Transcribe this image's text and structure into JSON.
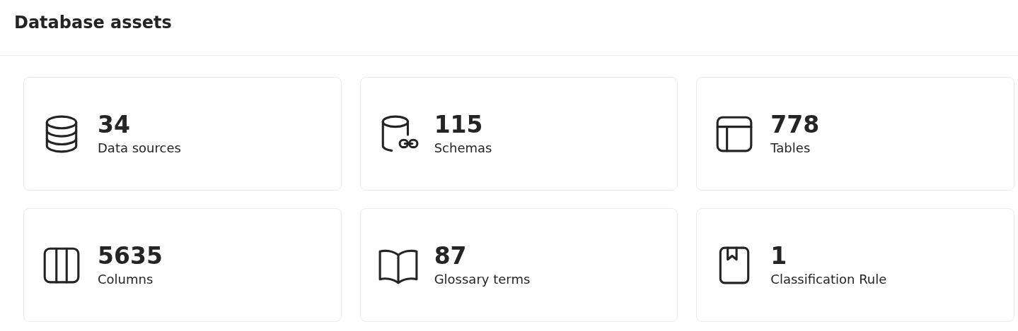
{
  "title": "Database assets",
  "cards": [
    {
      "kind": "database",
      "value": "34",
      "label": "Data sources"
    },
    {
      "kind": "schema",
      "value": "115",
      "label": "Schemas"
    },
    {
      "kind": "table",
      "value": "778",
      "label": "Tables"
    },
    {
      "kind": "columns",
      "value": "5635",
      "label": "Columns"
    },
    {
      "kind": "book",
      "value": "87",
      "label": "Glossary terms"
    },
    {
      "kind": "bookmark",
      "value": "1",
      "label": "Classification Rule"
    }
  ]
}
